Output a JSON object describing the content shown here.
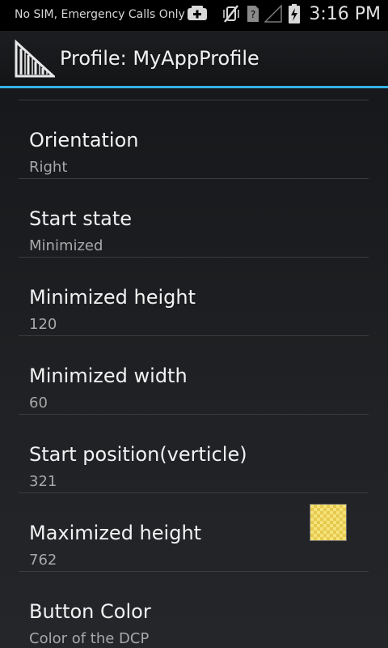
{
  "status_bar": {
    "carrier": "No SIM, Emergency Calls Only",
    "time": "3:16 PM",
    "icons": [
      "usb-debug-icon",
      "vibrate-off-icon",
      "no-sim-icon",
      "signal-icon",
      "battery-charging-icon"
    ]
  },
  "action_bar": {
    "icon": "barcode-app-icon",
    "title": "Profile: MyAppProfile",
    "accent_color": "#33b5e5"
  },
  "preferences": [
    {
      "title": "Orientation",
      "summary": "Right"
    },
    {
      "title": "Start state",
      "summary": "Minimized"
    },
    {
      "title": "Minimized height",
      "summary": "120"
    },
    {
      "title": "Minimized width",
      "summary": "60"
    },
    {
      "title": "Start position(verticle)",
      "summary": "321"
    },
    {
      "title": "Maximized height",
      "summary": "762"
    },
    {
      "title": "Button Color",
      "summary": "Color of the DCP",
      "swatch_color": "#f5e27a"
    }
  ]
}
